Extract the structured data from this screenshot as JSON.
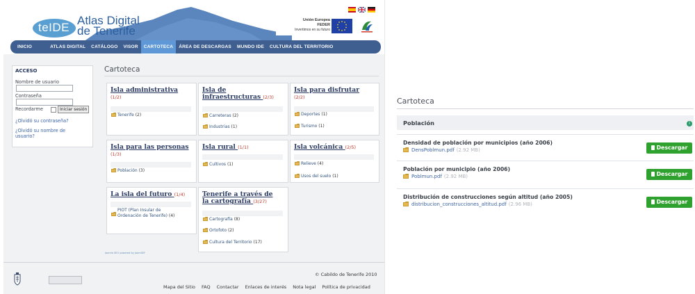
{
  "header": {
    "logo_tag": "teIDE",
    "logo_line1": "Atlas Digital",
    "logo_line2": "de Tenerife",
    "eu_title": "Unión Europea",
    "eu_sub": "FEDER",
    "eu_motto": "Invertimos en su futuro",
    "flags": [
      "es",
      "en",
      "de"
    ]
  },
  "nav": {
    "items": [
      "INICIO",
      "ATLAS DIGITAL",
      "CATÁLOGO",
      "VISOR",
      "CARTOTECA",
      "ÁREA DE DESCARGAS",
      "MUNDO IDE",
      "CULTURA DEL TERRITORIO"
    ],
    "active": "CARTOTECA"
  },
  "login": {
    "title": "ACCESO",
    "user_label": "Nombre de usuario",
    "pass_label": "Contraseña",
    "remember": "Recordarme",
    "submit": "Iniciar sesión",
    "forgot_pass": "¿Olvidó su contraseña?",
    "forgot_user": "¿Olvidó su nombre de usuario?"
  },
  "main": {
    "title": "Cartoteca",
    "cards": [
      {
        "title": "Isla administrativa",
        "count": "(1/2)",
        "items": [
          {
            "label": "Tenerife",
            "n": "(2)"
          }
        ]
      },
      {
        "title": "Isla de infraestructuras",
        "count": "(2/3)",
        "items": [
          {
            "label": "Carreteras",
            "n": "(2)"
          },
          {
            "label": "Industrias",
            "n": "(1)"
          }
        ]
      },
      {
        "title": "Isla para disfrutar",
        "count": "(2/2)",
        "items": [
          {
            "label": "Deportes",
            "n": "(1)"
          },
          {
            "label": "Turismo",
            "n": "(1)"
          }
        ]
      },
      {
        "title": "Isla para las personas",
        "count": "(1/3)",
        "items": [
          {
            "label": "Población",
            "n": "(3)"
          }
        ]
      },
      {
        "title": "Isla rural",
        "count": "(1/1)",
        "items": [
          {
            "label": "Cultivos",
            "n": "(1)"
          }
        ]
      },
      {
        "title": "Isla volcánica",
        "count": "(2/5)",
        "items": [
          {
            "label": "Relieve",
            "n": "(4)"
          },
          {
            "label": "Usos del suelo",
            "n": "(1)"
          }
        ]
      },
      {
        "title": "La isla del futuro",
        "count": "(1/4)",
        "items": [
          {
            "label": "PIOT (Plan Insular de Ordenación de Tenerife)",
            "n": "(4)"
          }
        ]
      },
      {
        "title": "Tenerife a través de la cartografía",
        "count": "(3/27)",
        "items": [
          {
            "label": "Cartografía",
            "n": "(8)"
          },
          {
            "label": "Ortofoto",
            "n": "(2)"
          },
          {
            "label": "Cultura del Territorio",
            "n": "(17)"
          }
        ]
      }
    ],
    "powered": "Joomla SEO powered by JoomSEF"
  },
  "footer": {
    "copyright": "© Cabildo de Tenerife 2010",
    "links": [
      "Mapa del Sitio",
      "FAQ",
      "Contactar",
      "Enlaces de interés",
      "Nota legal",
      "Política de privacidad"
    ]
  },
  "panel": {
    "title": "Cartoteca",
    "section": "Población",
    "rows": [
      {
        "name": "Densidad de población por municipios (año 2006)",
        "file": "DensPoblmun.pdf",
        "size": "(2.92 MB)",
        "button": "Descargar"
      },
      {
        "name": "Población por municipio (año 2006)",
        "file": "Poblmun.pdf",
        "size": "(2.92 MB)",
        "button": "Descargar"
      },
      {
        "name": "Distribución de construcciones según altitud (año 2005)",
        "file": "distribucion_construcciones_altitud.pdf",
        "size": "(2.96 MB)",
        "button": "Descargar"
      }
    ]
  },
  "colors": {
    "nav_bg": "#405f91",
    "nav_active": "#5f98d6",
    "download_green": "#2fa12e",
    "heading_blue": "#2a3a62",
    "count_red": "#c0392b"
  }
}
